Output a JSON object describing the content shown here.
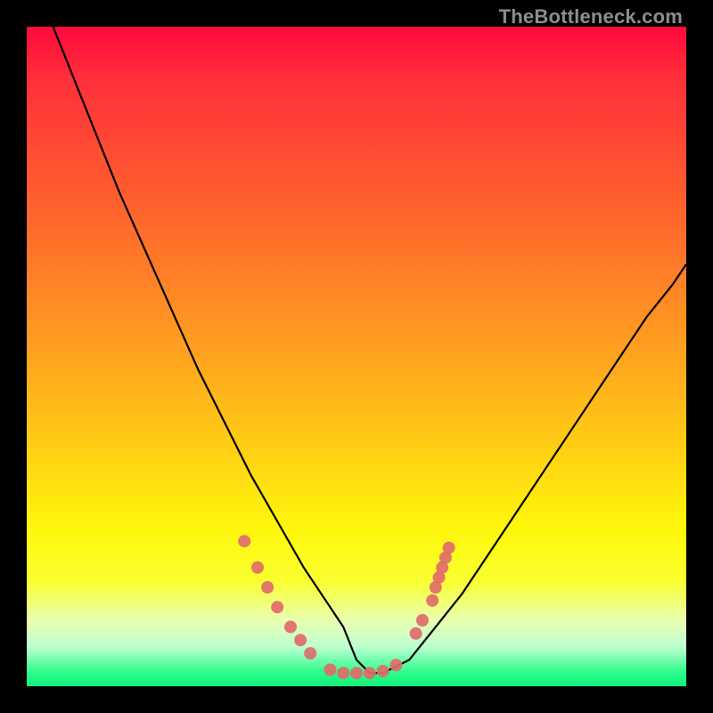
{
  "watermark": "TheBottleneck.com",
  "chart_data": {
    "type": "line",
    "title": "",
    "xlabel": "",
    "ylabel": "",
    "xlim": [
      0,
      100
    ],
    "ylim": [
      0,
      100
    ],
    "grid": false,
    "legend": false,
    "series": [
      {
        "name": "curve",
        "x": [
          4,
          6,
          10,
          14,
          18,
          22,
          26,
          30,
          34,
          38,
          42,
          46,
          48,
          50,
          52,
          54,
          58,
          62,
          66,
          70,
          74,
          78,
          82,
          86,
          90,
          94,
          98,
          100
        ],
        "y": [
          100,
          95,
          85,
          75,
          66,
          57,
          48,
          40,
          32,
          25,
          18,
          12,
          9,
          4,
          2,
          2,
          4,
          9,
          14,
          20,
          26,
          32,
          38,
          44,
          50,
          56,
          61,
          64
        ]
      }
    ],
    "highlight_band": {
      "y_min": 0,
      "y_max": 4,
      "color": "#11f27b"
    },
    "markers": {
      "color": "#e06b6b",
      "points": [
        {
          "x": 33,
          "y": 22
        },
        {
          "x": 35,
          "y": 18
        },
        {
          "x": 36.5,
          "y": 15
        },
        {
          "x": 38,
          "y": 12
        },
        {
          "x": 40,
          "y": 9
        },
        {
          "x": 41.5,
          "y": 7
        },
        {
          "x": 43,
          "y": 5
        },
        {
          "x": 46,
          "y": 2.5
        },
        {
          "x": 48,
          "y": 2
        },
        {
          "x": 50,
          "y": 2
        },
        {
          "x": 52,
          "y": 2
        },
        {
          "x": 54,
          "y": 2.3
        },
        {
          "x": 56,
          "y": 3.2
        },
        {
          "x": 59,
          "y": 8
        },
        {
          "x": 60,
          "y": 10
        },
        {
          "x": 61.5,
          "y": 13
        },
        {
          "x": 62,
          "y": 15
        },
        {
          "x": 62.5,
          "y": 16.5
        },
        {
          "x": 63,
          "y": 18
        },
        {
          "x": 63.5,
          "y": 19.5
        },
        {
          "x": 64,
          "y": 21
        }
      ]
    }
  }
}
